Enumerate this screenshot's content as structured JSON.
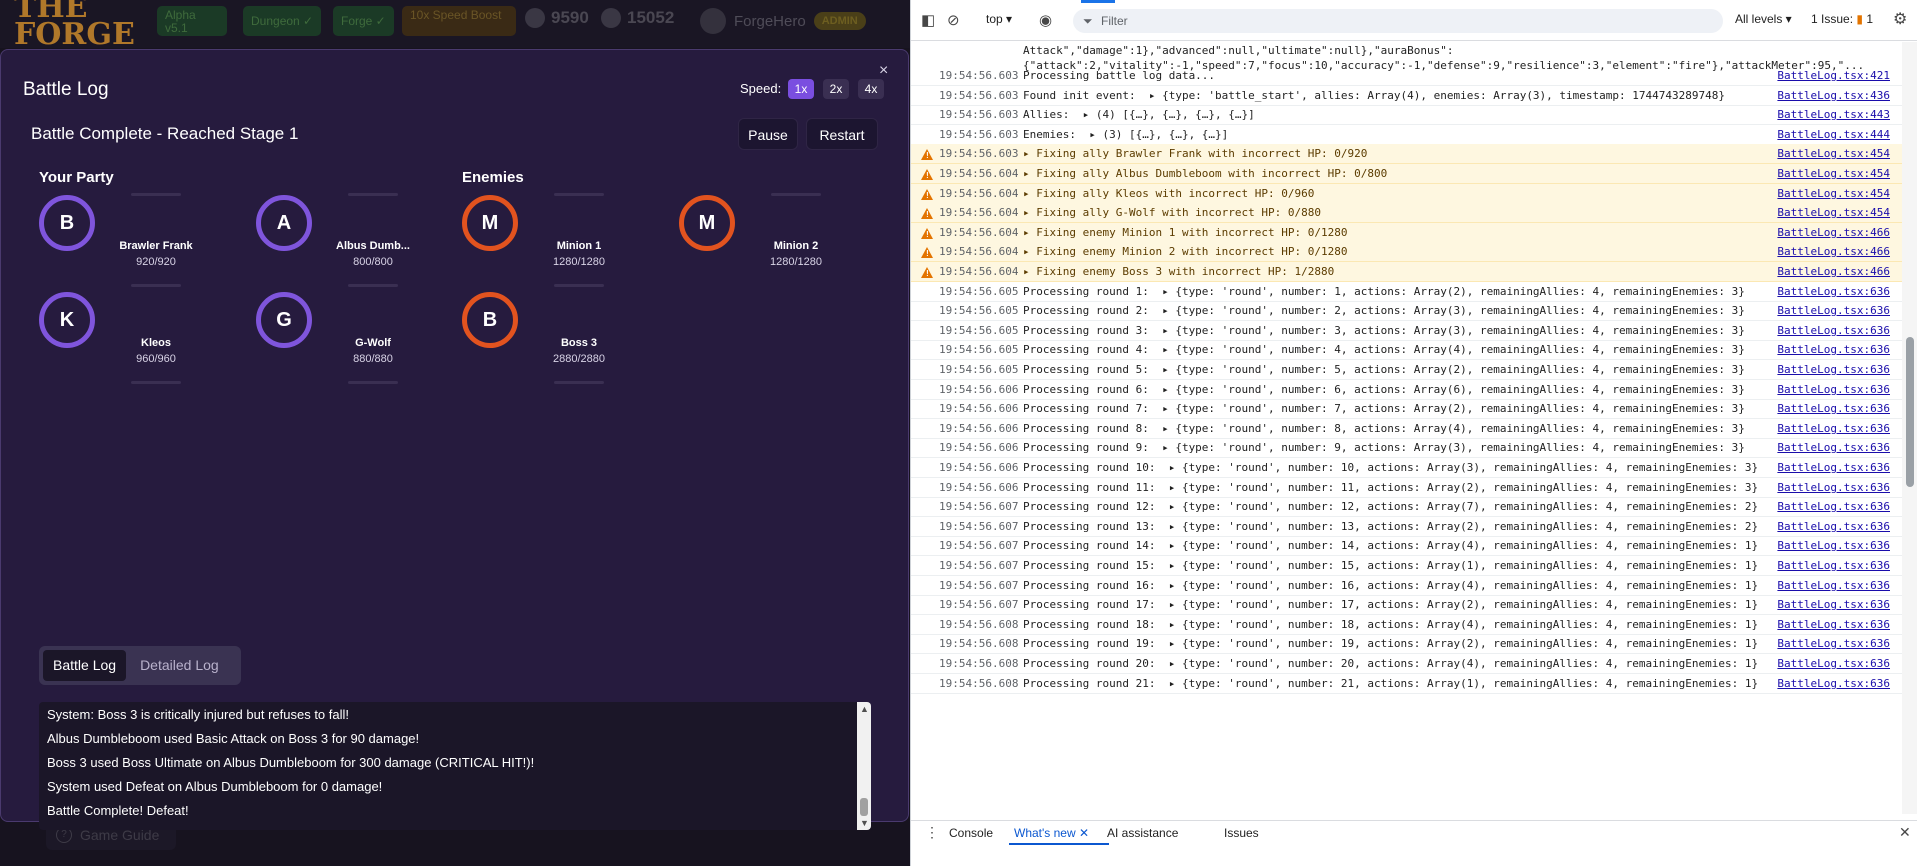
{
  "app": {
    "logo": "THE FORGE",
    "chips": {
      "alpha": "Alpha v5.1",
      "dungeon": "Dungeon ✓",
      "forge": "Forge ✓",
      "boost": "10x Speed Boost"
    },
    "currency1": "9590",
    "currency2": "15052",
    "username": "ForgeHero",
    "admin": "ADMIN",
    "guide": "Game Guide"
  },
  "modal": {
    "title": "Battle Log",
    "speed_label": "Speed:",
    "speeds": [
      "1x",
      "2x",
      "4x"
    ],
    "close": "×",
    "status": "Battle Complete - Reached Stage 1",
    "pause": "Pause",
    "restart": "Restart",
    "party_title": "Your Party",
    "enemies_title": "Enemies",
    "party": [
      {
        "initial": "B",
        "name": "Brawler Frank",
        "hp": "920/920"
      },
      {
        "initial": "A",
        "name": "Albus Dumb...",
        "hp": "800/800"
      },
      {
        "initial": "K",
        "name": "Kleos",
        "hp": "960/960"
      },
      {
        "initial": "G",
        "name": "G-Wolf",
        "hp": "880/880"
      }
    ],
    "enemies": [
      {
        "initial": "M",
        "name": "Minion 1",
        "hp": "1280/1280"
      },
      {
        "initial": "M",
        "name": "Minion 2",
        "hp": "1280/1280"
      },
      {
        "initial": "B",
        "name": "Boss 3",
        "hp": "2880/2880"
      }
    ],
    "tabs": [
      "Battle Log",
      "Detailed Log"
    ],
    "log_lines": [
      "System: Boss 3 is critically injured but refuses to fall!",
      "Albus Dumbleboom used Basic Attack on Boss 3 for 90 damage!",
      "Boss 3 used Boss Ultimate on Albus Dumbleboom for 300 damage (CRITICAL HIT!)!",
      "System used Defeat on Albus Dumbleboom for 0 damage!",
      "Battle Complete! Defeat!"
    ]
  },
  "devtools": {
    "context": "top ▾",
    "filter_placeholder": "Filter",
    "levels": "All levels ▾",
    "issues_label": "1 Issue:",
    "issues_count": "1",
    "top_fragment_1": "Attack\",\"damage\":1},\"advanced\":null,\"ultimate\":null},\"auraBonus\":",
    "top_fragment_2": "{\"attack\":2,\"vitality\":-1,\"speed\":7,\"focus\":10,\"accuracy\":-1,\"defense\":9,\"resilience\":3,\"element\":\"fire\"},\"attackMeter\":95,\"...",
    "entries": [
      {
        "ts": "19:54:56.603",
        "msg": "Processing battle log data...",
        "src": "BattleLog.tsx:421",
        "warn": false
      },
      {
        "ts": "19:54:56.603",
        "msg": "Found init event:  ▸ {type: 'battle_start', allies: Array(4), enemies: Array(3), timestamp: 1744743289748}",
        "src": "BattleLog.tsx:436",
        "warn": false
      },
      {
        "ts": "19:54:56.603",
        "msg": "Allies:  ▸ (4) [{…}, {…}, {…}, {…}]",
        "src": "BattleLog.tsx:443",
        "warn": false
      },
      {
        "ts": "19:54:56.603",
        "msg": "Enemies:  ▸ (3) [{…}, {…}, {…}]",
        "src": "BattleLog.tsx:444",
        "warn": false
      },
      {
        "ts": "19:54:56.603",
        "msg": "▸ Fixing ally Brawler Frank with incorrect HP: 0/920",
        "src": "BattleLog.tsx:454",
        "warn": true
      },
      {
        "ts": "19:54:56.604",
        "msg": "▸ Fixing ally Albus Dumbleboom with incorrect HP: 0/800",
        "src": "BattleLog.tsx:454",
        "warn": true
      },
      {
        "ts": "19:54:56.604",
        "msg": "▸ Fixing ally Kleos with incorrect HP: 0/960",
        "src": "BattleLog.tsx:454",
        "warn": true
      },
      {
        "ts": "19:54:56.604",
        "msg": "▸ Fixing ally G-Wolf with incorrect HP: 0/880",
        "src": "BattleLog.tsx:454",
        "warn": true
      },
      {
        "ts": "19:54:56.604",
        "msg": "▸ Fixing enemy Minion 1 with incorrect HP: 0/1280",
        "src": "BattleLog.tsx:466",
        "warn": true
      },
      {
        "ts": "19:54:56.604",
        "msg": "▸ Fixing enemy Minion 2 with incorrect HP: 0/1280",
        "src": "BattleLog.tsx:466",
        "warn": true
      },
      {
        "ts": "19:54:56.604",
        "msg": "▸ Fixing enemy Boss 3 with incorrect HP: 1/2880",
        "src": "BattleLog.tsx:466",
        "warn": true
      },
      {
        "ts": "19:54:56.605",
        "msg": "Processing round 1:  ▸ {type: 'round', number: 1, actions: Array(2), remainingAllies: 4, remainingEnemies: 3}",
        "src": "BattleLog.tsx:636",
        "warn": false
      },
      {
        "ts": "19:54:56.605",
        "msg": "Processing round 2:  ▸ {type: 'round', number: 2, actions: Array(3), remainingAllies: 4, remainingEnemies: 3}",
        "src": "BattleLog.tsx:636",
        "warn": false
      },
      {
        "ts": "19:54:56.605",
        "msg": "Processing round 3:  ▸ {type: 'round', number: 3, actions: Array(3), remainingAllies: 4, remainingEnemies: 3}",
        "src": "BattleLog.tsx:636",
        "warn": false
      },
      {
        "ts": "19:54:56.605",
        "msg": "Processing round 4:  ▸ {type: 'round', number: 4, actions: Array(4), remainingAllies: 4, remainingEnemies: 3}",
        "src": "BattleLog.tsx:636",
        "warn": false
      },
      {
        "ts": "19:54:56.605",
        "msg": "Processing round 5:  ▸ {type: 'round', number: 5, actions: Array(2), remainingAllies: 4, remainingEnemies: 3}",
        "src": "BattleLog.tsx:636",
        "warn": false
      },
      {
        "ts": "19:54:56.606",
        "msg": "Processing round 6:  ▸ {type: 'round', number: 6, actions: Array(6), remainingAllies: 4, remainingEnemies: 3}",
        "src": "BattleLog.tsx:636",
        "warn": false
      },
      {
        "ts": "19:54:56.606",
        "msg": "Processing round 7:  ▸ {type: 'round', number: 7, actions: Array(2), remainingAllies: 4, remainingEnemies: 3}",
        "src": "BattleLog.tsx:636",
        "warn": false
      },
      {
        "ts": "19:54:56.606",
        "msg": "Processing round 8:  ▸ {type: 'round', number: 8, actions: Array(4), remainingAllies: 4, remainingEnemies: 3}",
        "src": "BattleLog.tsx:636",
        "warn": false
      },
      {
        "ts": "19:54:56.606",
        "msg": "Processing round 9:  ▸ {type: 'round', number: 9, actions: Array(3), remainingAllies: 4, remainingEnemies: 3}",
        "src": "BattleLog.tsx:636",
        "warn": false
      },
      {
        "ts": "19:54:56.606",
        "msg": "Processing round 10:  ▸ {type: 'round', number: 10, actions: Array(3), remainingAllies: 4, remainingEnemies: 3}",
        "src": "BattleLog.tsx:636",
        "warn": false
      },
      {
        "ts": "19:54:56.606",
        "msg": "Processing round 11:  ▸ {type: 'round', number: 11, actions: Array(2), remainingAllies: 4, remainingEnemies: 3}",
        "src": "BattleLog.tsx:636",
        "warn": false
      },
      {
        "ts": "19:54:56.607",
        "msg": "Processing round 12:  ▸ {type: 'round', number: 12, actions: Array(7), remainingAllies: 4, remainingEnemies: 2}",
        "src": "BattleLog.tsx:636",
        "warn": false
      },
      {
        "ts": "19:54:56.607",
        "msg": "Processing round 13:  ▸ {type: 'round', number: 13, actions: Array(2), remainingAllies: 4, remainingEnemies: 2}",
        "src": "BattleLog.tsx:636",
        "warn": false
      },
      {
        "ts": "19:54:56.607",
        "msg": "Processing round 14:  ▸ {type: 'round', number: 14, actions: Array(4), remainingAllies: 4, remainingEnemies: 1}",
        "src": "BattleLog.tsx:636",
        "warn": false
      },
      {
        "ts": "19:54:56.607",
        "msg": "Processing round 15:  ▸ {type: 'round', number: 15, actions: Array(1), remainingAllies: 4, remainingEnemies: 1}",
        "src": "BattleLog.tsx:636",
        "warn": false
      },
      {
        "ts": "19:54:56.607",
        "msg": "Processing round 16:  ▸ {type: 'round', number: 16, actions: Array(4), remainingAllies: 4, remainingEnemies: 1}",
        "src": "BattleLog.tsx:636",
        "warn": false
      },
      {
        "ts": "19:54:56.607",
        "msg": "Processing round 17:  ▸ {type: 'round', number: 17, actions: Array(2), remainingAllies: 4, remainingEnemies: 1}",
        "src": "BattleLog.tsx:636",
        "warn": false
      },
      {
        "ts": "19:54:56.608",
        "msg": "Processing round 18:  ▸ {type: 'round', number: 18, actions: Array(4), remainingAllies: 4, remainingEnemies: 1}",
        "src": "BattleLog.tsx:636",
        "warn": false
      },
      {
        "ts": "19:54:56.608",
        "msg": "Processing round 19:  ▸ {type: 'round', number: 19, actions: Array(2), remainingAllies: 4, remainingEnemies: 1}",
        "src": "BattleLog.tsx:636",
        "warn": false
      },
      {
        "ts": "19:54:56.608",
        "msg": "Processing round 20:  ▸ {type: 'round', number: 20, actions: Array(4), remainingAllies: 4, remainingEnemies: 1}",
        "src": "BattleLog.tsx:636",
        "warn": false
      },
      {
        "ts": "19:54:56.608",
        "msg": "Processing round 21:  ▸ {type: 'round', number: 21, actions: Array(1), remainingAllies: 4, remainingEnemies: 1}",
        "src": "BattleLog.tsx:636",
        "warn": false
      }
    ],
    "drawer_tabs": [
      "Console",
      "What's new",
      "AI assistance",
      "Issues"
    ]
  }
}
